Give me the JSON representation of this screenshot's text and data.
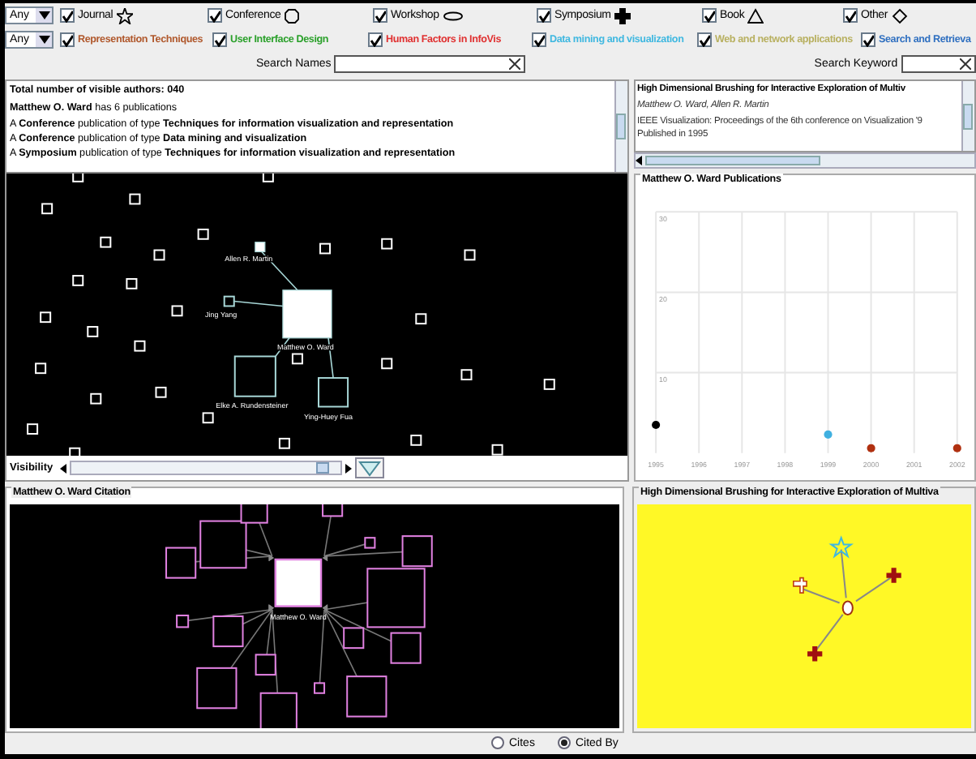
{
  "type_filter": {
    "any": "Any",
    "items": [
      {
        "label": "Journal",
        "checked": true,
        "kind": "star"
      },
      {
        "label": "Conference",
        "checked": true,
        "kind": "circle"
      },
      {
        "label": "Workshop",
        "checked": true,
        "kind": "ellipse"
      },
      {
        "label": "Symposium",
        "checked": true,
        "kind": "cross"
      },
      {
        "label": "Book",
        "checked": true,
        "kind": "triangle"
      },
      {
        "label": "Other",
        "checked": true,
        "kind": "diamond"
      }
    ]
  },
  "topic_filter": {
    "any": "Any",
    "items": [
      {
        "label": "Representation Techniques",
        "checked": true,
        "color": "#b0582c"
      },
      {
        "label": "User Interface Design",
        "checked": true,
        "color": "#2aa02a"
      },
      {
        "label": "Human Factors in InfoVis",
        "checked": true,
        "color": "#e03030"
      },
      {
        "label": "Data mining and visualization",
        "checked": true,
        "color": "#40b8e0"
      },
      {
        "label": "Web and network applications",
        "checked": true,
        "color": "#b8b060"
      },
      {
        "label": "Search and Retrieva",
        "checked": true,
        "color": "#3070c0"
      }
    ]
  },
  "search_names": {
    "label": "Search Names"
  },
  "search_keyword": {
    "label": "Search Keyword"
  },
  "author_info": {
    "lines": [
      "**Total number of visible authors: 040**",
      "**Matthew O. Ward** has 6 publications",
      "A **Conference** publication of type **Techniques for information visualization and representation**",
      "A **Conference** publication of type **Data mining and visualization**",
      "A **Symposium** publication of type **Techniques for information visualization and representation**"
    ]
  },
  "author_graph": {
    "nodes": [
      {
        "label": "Allen R. Martin",
        "kind": "filled"
      },
      {
        "label": "Jing Yang",
        "kind": "outline"
      },
      {
        "label": "Matthew O. Ward",
        "kind": "focus"
      },
      {
        "label": "Elke A. Rundensteiner",
        "kind": "outline"
      },
      {
        "label": "Ying-Huey Fua",
        "kind": "outline"
      }
    ]
  },
  "visibility": {
    "label": "Visibility",
    "level": 0.96
  },
  "paper_info": {
    "title": "High Dimensional Brushing for Interactive Exploration of Multiv",
    "authors": "Matthew O. Ward, Allen R. Martin",
    "venue": "IEEE Visualization: Proceedings of the 6th conference on Visualization '9",
    "published": "Published in 1995"
  },
  "publications_panel": {
    "title": "Matthew O. Ward Publications",
    "chart_data": {
      "type": "scatter",
      "x": [
        1995,
        1999,
        2000,
        2002
      ],
      "series": [
        {
          "color": "#000000",
          "values": [
            3.5,
            null,
            null,
            null
          ]
        },
        {
          "color": "#40b0e0",
          "values": [
            null,
            2.3,
            null,
            null
          ]
        },
        {
          "color": "#b03010",
          "values": [
            null,
            null,
            0.6,
            0.6
          ]
        }
      ],
      "grid": true,
      "xlim": [
        1995,
        2002
      ],
      "ylim": [
        0,
        30
      ],
      "xticks": [
        1995,
        1996,
        1997,
        1998,
        1999,
        2000,
        2001,
        2002
      ],
      "yticks": [
        10,
        20,
        30
      ]
    }
  },
  "citation_panel": {
    "title": "Matthew O. Ward Citation",
    "center_label": "Matthew O. Ward"
  },
  "paper_panel": {
    "title": "High Dimensional Brushing for Interactive Exploration of Multiva"
  },
  "citation_mode": [
    {
      "label": "Cites",
      "selected": false
    },
    {
      "label": "Cited By",
      "selected": true
    }
  ]
}
